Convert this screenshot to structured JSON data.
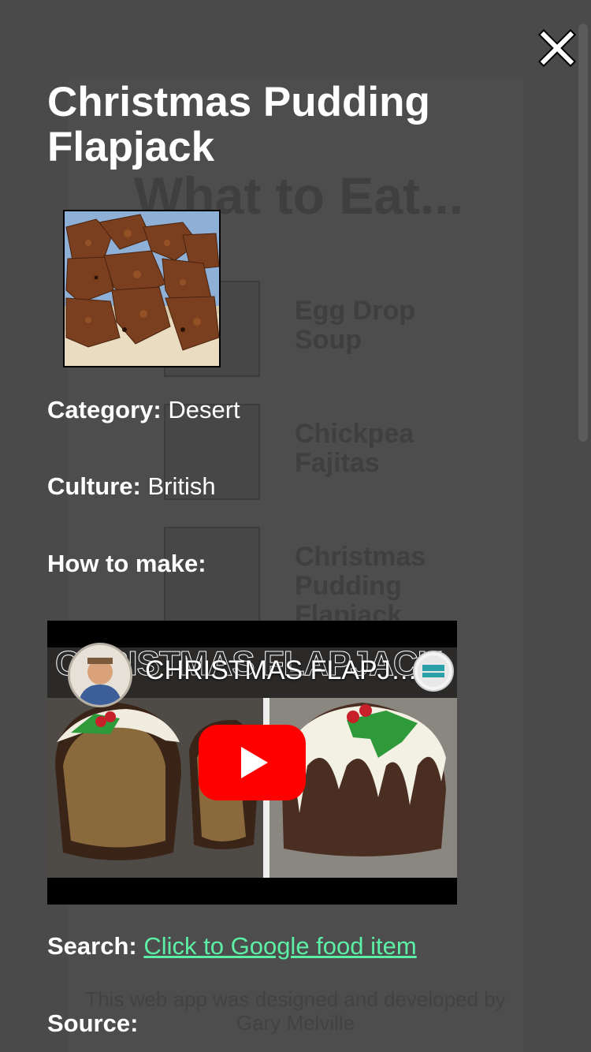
{
  "background": {
    "title": "What to Eat...",
    "items": [
      {
        "label": "Egg Drop Soup"
      },
      {
        "label": "Chickpea Fajitas"
      },
      {
        "label": "Christmas Pudding Flapjack"
      }
    ],
    "footer": "This web app was designed and developed by Gary Melville"
  },
  "modal": {
    "close_icon": "close-icon",
    "title": "Christmas Pudding Flapjack",
    "image_alt": "Christmas Pudding Flapjack",
    "category_label": "Category:",
    "category_value": "Desert",
    "culture_label": "Culture:",
    "culture_value": "British",
    "how_label": "How to make:",
    "video": {
      "title": "CHRISTMAS FLAPJA...",
      "thumbnail_text": "CHRISTMAS FLAPJACK",
      "channel_icon": "channel-avatar-icon",
      "play_icon": "youtube-play-icon"
    },
    "search_label": "Search:",
    "search_link": "Click to Google food item",
    "source_label": "Source:"
  },
  "colors": {
    "overlay": "#4a4a4a",
    "text": "#ffffff",
    "link": "#5cf0a6",
    "youtube_red": "#ff0000"
  }
}
